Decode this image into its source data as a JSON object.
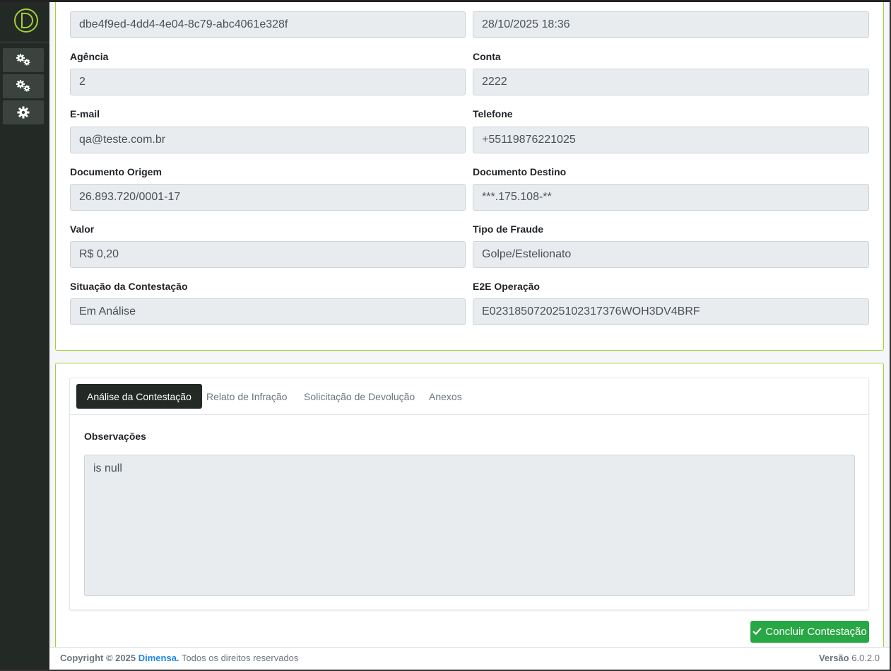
{
  "sidebar": {
    "logo": "dimensa-logo",
    "items": [
      {
        "icon": "gears-icon"
      },
      {
        "icon": "gears-icon"
      },
      {
        "icon": "gear-icon"
      }
    ]
  },
  "details": {
    "row0": {
      "left_value": "dbe4f9ed-4dd4-4e04-8c79-abc4061e328f",
      "right_value": "28/10/2025 18:36"
    },
    "agencia": {
      "label": "Agência",
      "value": "2"
    },
    "conta": {
      "label": "Conta",
      "value": "2222"
    },
    "email": {
      "label": "E-mail",
      "value": "qa@teste.com.br"
    },
    "telefone": {
      "label": "Telefone",
      "value": "+55119876221025"
    },
    "doc_origem": {
      "label": "Documento Origem",
      "value": "26.893.720/0001-17"
    },
    "doc_destino": {
      "label": "Documento Destino",
      "value": "***.175.108-**"
    },
    "valor": {
      "label": "Valor",
      "value": "R$ 0,20"
    },
    "tipo_fraude": {
      "label": "Tipo de Fraude",
      "value": "Golpe/Estelionato"
    },
    "situacao": {
      "label": "Situação da Contestação",
      "value": "Em Análise"
    },
    "e2e": {
      "label": "E2E Operação",
      "value": "E02318507202510231737​6WOH3DV4BRF"
    }
  },
  "tabs": [
    {
      "label": "Análise da Contestação",
      "active": true
    },
    {
      "label": "Relato de Infração",
      "active": false
    },
    {
      "label": "Solicitação de Devolução",
      "active": false
    },
    {
      "label": "Anexos",
      "active": false
    }
  ],
  "observacoes": {
    "label": "Observações",
    "value": "is null"
  },
  "actions": {
    "conclude_label": "Concluir Contestação"
  },
  "footer": {
    "copyright": "Copyright © 2025",
    "brand": "Dimensa.",
    "rights": "Todos os direitos reservados",
    "version_label": "Versão",
    "version": "6.0.2.0"
  },
  "colors": {
    "accent": "#a6ce39",
    "sidebar": "#232a26",
    "success": "#28a745",
    "link": "#1e88e5"
  }
}
